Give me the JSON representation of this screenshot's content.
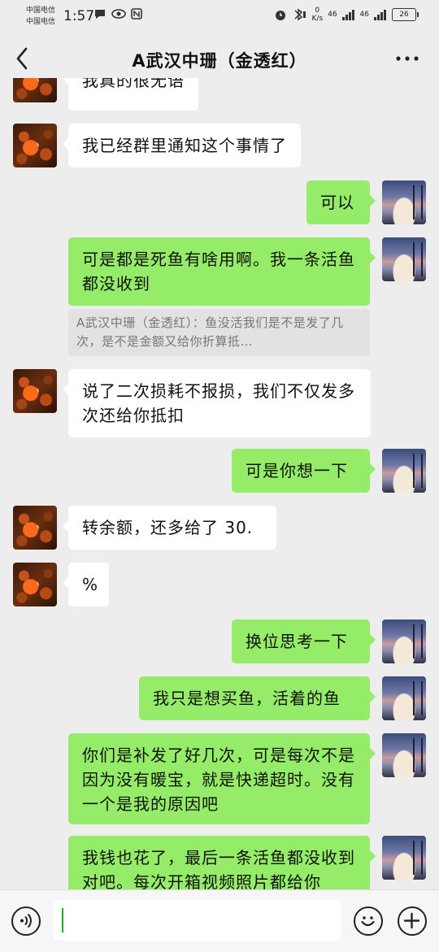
{
  "status_bar": {
    "carrier_1": "中国电信",
    "carrier_2": "中国电信",
    "time": "1:57",
    "net_speed_top": "0",
    "net_speed_bottom": "K/s",
    "signal_1": "46",
    "signal_2": "46",
    "battery": "26"
  },
  "header": {
    "title": "A武汉中珊（金透红）"
  },
  "messages": [
    {
      "side": "left",
      "text": "我真的很无语"
    },
    {
      "side": "left",
      "text": "我已经群里通知这个事情了"
    },
    {
      "side": "right",
      "text": "可以"
    },
    {
      "side": "right",
      "text": "可是都是死鱼有啥用啊。我一条活鱼都没收到"
    },
    {
      "side": "right",
      "quote": "A武汉中珊（金透红）：鱼没活我们是不是发了几次，是不是金额又给你折算抵…"
    },
    {
      "side": "left",
      "text": "说了二次损耗不报损，我们不仅发多次还给你抵扣"
    },
    {
      "side": "right",
      "text": "可是你想一下"
    },
    {
      "side": "left",
      "text": "转余额，还多给了 30."
    },
    {
      "side": "left",
      "text": "%"
    },
    {
      "side": "right",
      "text": "换位思考一下"
    },
    {
      "side": "right",
      "text": "我只是想买鱼，活着的鱼"
    },
    {
      "side": "right",
      "text": "你们是补发了好几次，可是每次不是因为没有暖宝，就是快递超时。没有一个是我的原因吧"
    },
    {
      "side": "right",
      "text": "我钱也花了，最后一条活鱼都没收到对吧。每次开箱视频照片都给你"
    }
  ],
  "input_bar": {
    "text": ""
  },
  "icons": {
    "back": "chevron-left-icon",
    "more": "more-dots-icon",
    "voice": "voice-icon",
    "emoji": "emoji-icon",
    "plus": "plus-icon"
  }
}
